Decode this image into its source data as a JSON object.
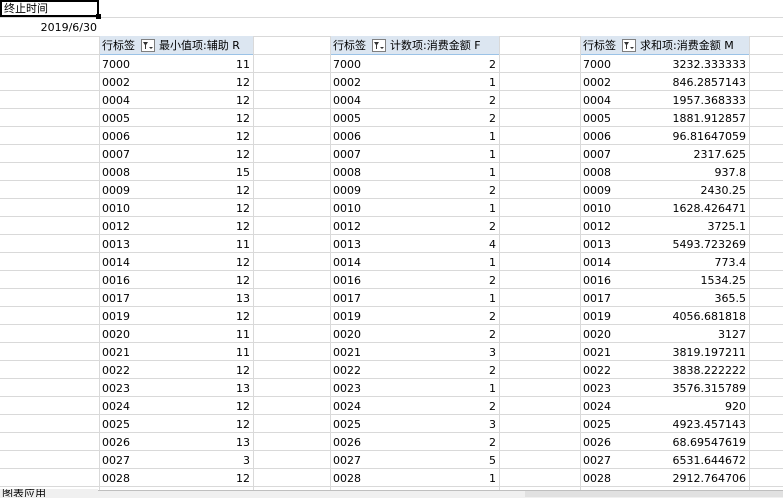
{
  "cell_a1": "终止时间",
  "cell_a2": "2019/6/30",
  "pivots": [
    {
      "row_label": "行标签",
      "value_header": "最小值项:辅助 R",
      "rows": [
        [
          "7000",
          "11"
        ],
        [
          "0002",
          "12"
        ],
        [
          "0004",
          "12"
        ],
        [
          "0005",
          "12"
        ],
        [
          "0006",
          "12"
        ],
        [
          "0007",
          "12"
        ],
        [
          "0008",
          "15"
        ],
        [
          "0009",
          "12"
        ],
        [
          "0010",
          "12"
        ],
        [
          "0012",
          "12"
        ],
        [
          "0013",
          "11"
        ],
        [
          "0014",
          "12"
        ],
        [
          "0016",
          "12"
        ],
        [
          "0017",
          "13"
        ],
        [
          "0019",
          "12"
        ],
        [
          "0020",
          "11"
        ],
        [
          "0021",
          "11"
        ],
        [
          "0022",
          "12"
        ],
        [
          "0023",
          "13"
        ],
        [
          "0024",
          "12"
        ],
        [
          "0025",
          "12"
        ],
        [
          "0026",
          "13"
        ],
        [
          "0027",
          "3"
        ],
        [
          "0028",
          "12"
        ]
      ]
    },
    {
      "row_label": "行标签",
      "value_header": "计数项:消费金额 F",
      "rows": [
        [
          "7000",
          "2"
        ],
        [
          "0002",
          "1"
        ],
        [
          "0004",
          "2"
        ],
        [
          "0005",
          "2"
        ],
        [
          "0006",
          "1"
        ],
        [
          "0007",
          "1"
        ],
        [
          "0008",
          "1"
        ],
        [
          "0009",
          "2"
        ],
        [
          "0010",
          "1"
        ],
        [
          "0012",
          "2"
        ],
        [
          "0013",
          "4"
        ],
        [
          "0014",
          "1"
        ],
        [
          "0016",
          "2"
        ],
        [
          "0017",
          "1"
        ],
        [
          "0019",
          "2"
        ],
        [
          "0020",
          "2"
        ],
        [
          "0021",
          "3"
        ],
        [
          "0022",
          "2"
        ],
        [
          "0023",
          "1"
        ],
        [
          "0024",
          "2"
        ],
        [
          "0025",
          "3"
        ],
        [
          "0026",
          "2"
        ],
        [
          "0027",
          "5"
        ],
        [
          "0028",
          "1"
        ]
      ]
    },
    {
      "row_label": "行标签",
      "value_header": "求和项:消费金额 M",
      "rows": [
        [
          "7000",
          "3232.333333"
        ],
        [
          "0002",
          "846.2857143"
        ],
        [
          "0004",
          "1957.368333"
        ],
        [
          "0005",
          "1881.912857"
        ],
        [
          "0006",
          "96.81647059"
        ],
        [
          "0007",
          "2317.625"
        ],
        [
          "0008",
          "937.8"
        ],
        [
          "0009",
          "2430.25"
        ],
        [
          "0010",
          "1628.426471"
        ],
        [
          "0012",
          "3725.1"
        ],
        [
          "0013",
          "5493.723269"
        ],
        [
          "0014",
          "773.4"
        ],
        [
          "0016",
          "1534.25"
        ],
        [
          "0017",
          "365.5"
        ],
        [
          "0019",
          "4056.681818"
        ],
        [
          "0020",
          "3127"
        ],
        [
          "0021",
          "3819.197211"
        ],
        [
          "0022",
          "3838.222222"
        ],
        [
          "0023",
          "3576.315789"
        ],
        [
          "0024",
          "920"
        ],
        [
          "0025",
          "4923.457143"
        ],
        [
          "0026",
          "68.69547619"
        ],
        [
          "0027",
          "6531.644672"
        ],
        [
          "0028",
          "2912.764706"
        ]
      ]
    }
  ],
  "sheet_tab": "图表应用"
}
